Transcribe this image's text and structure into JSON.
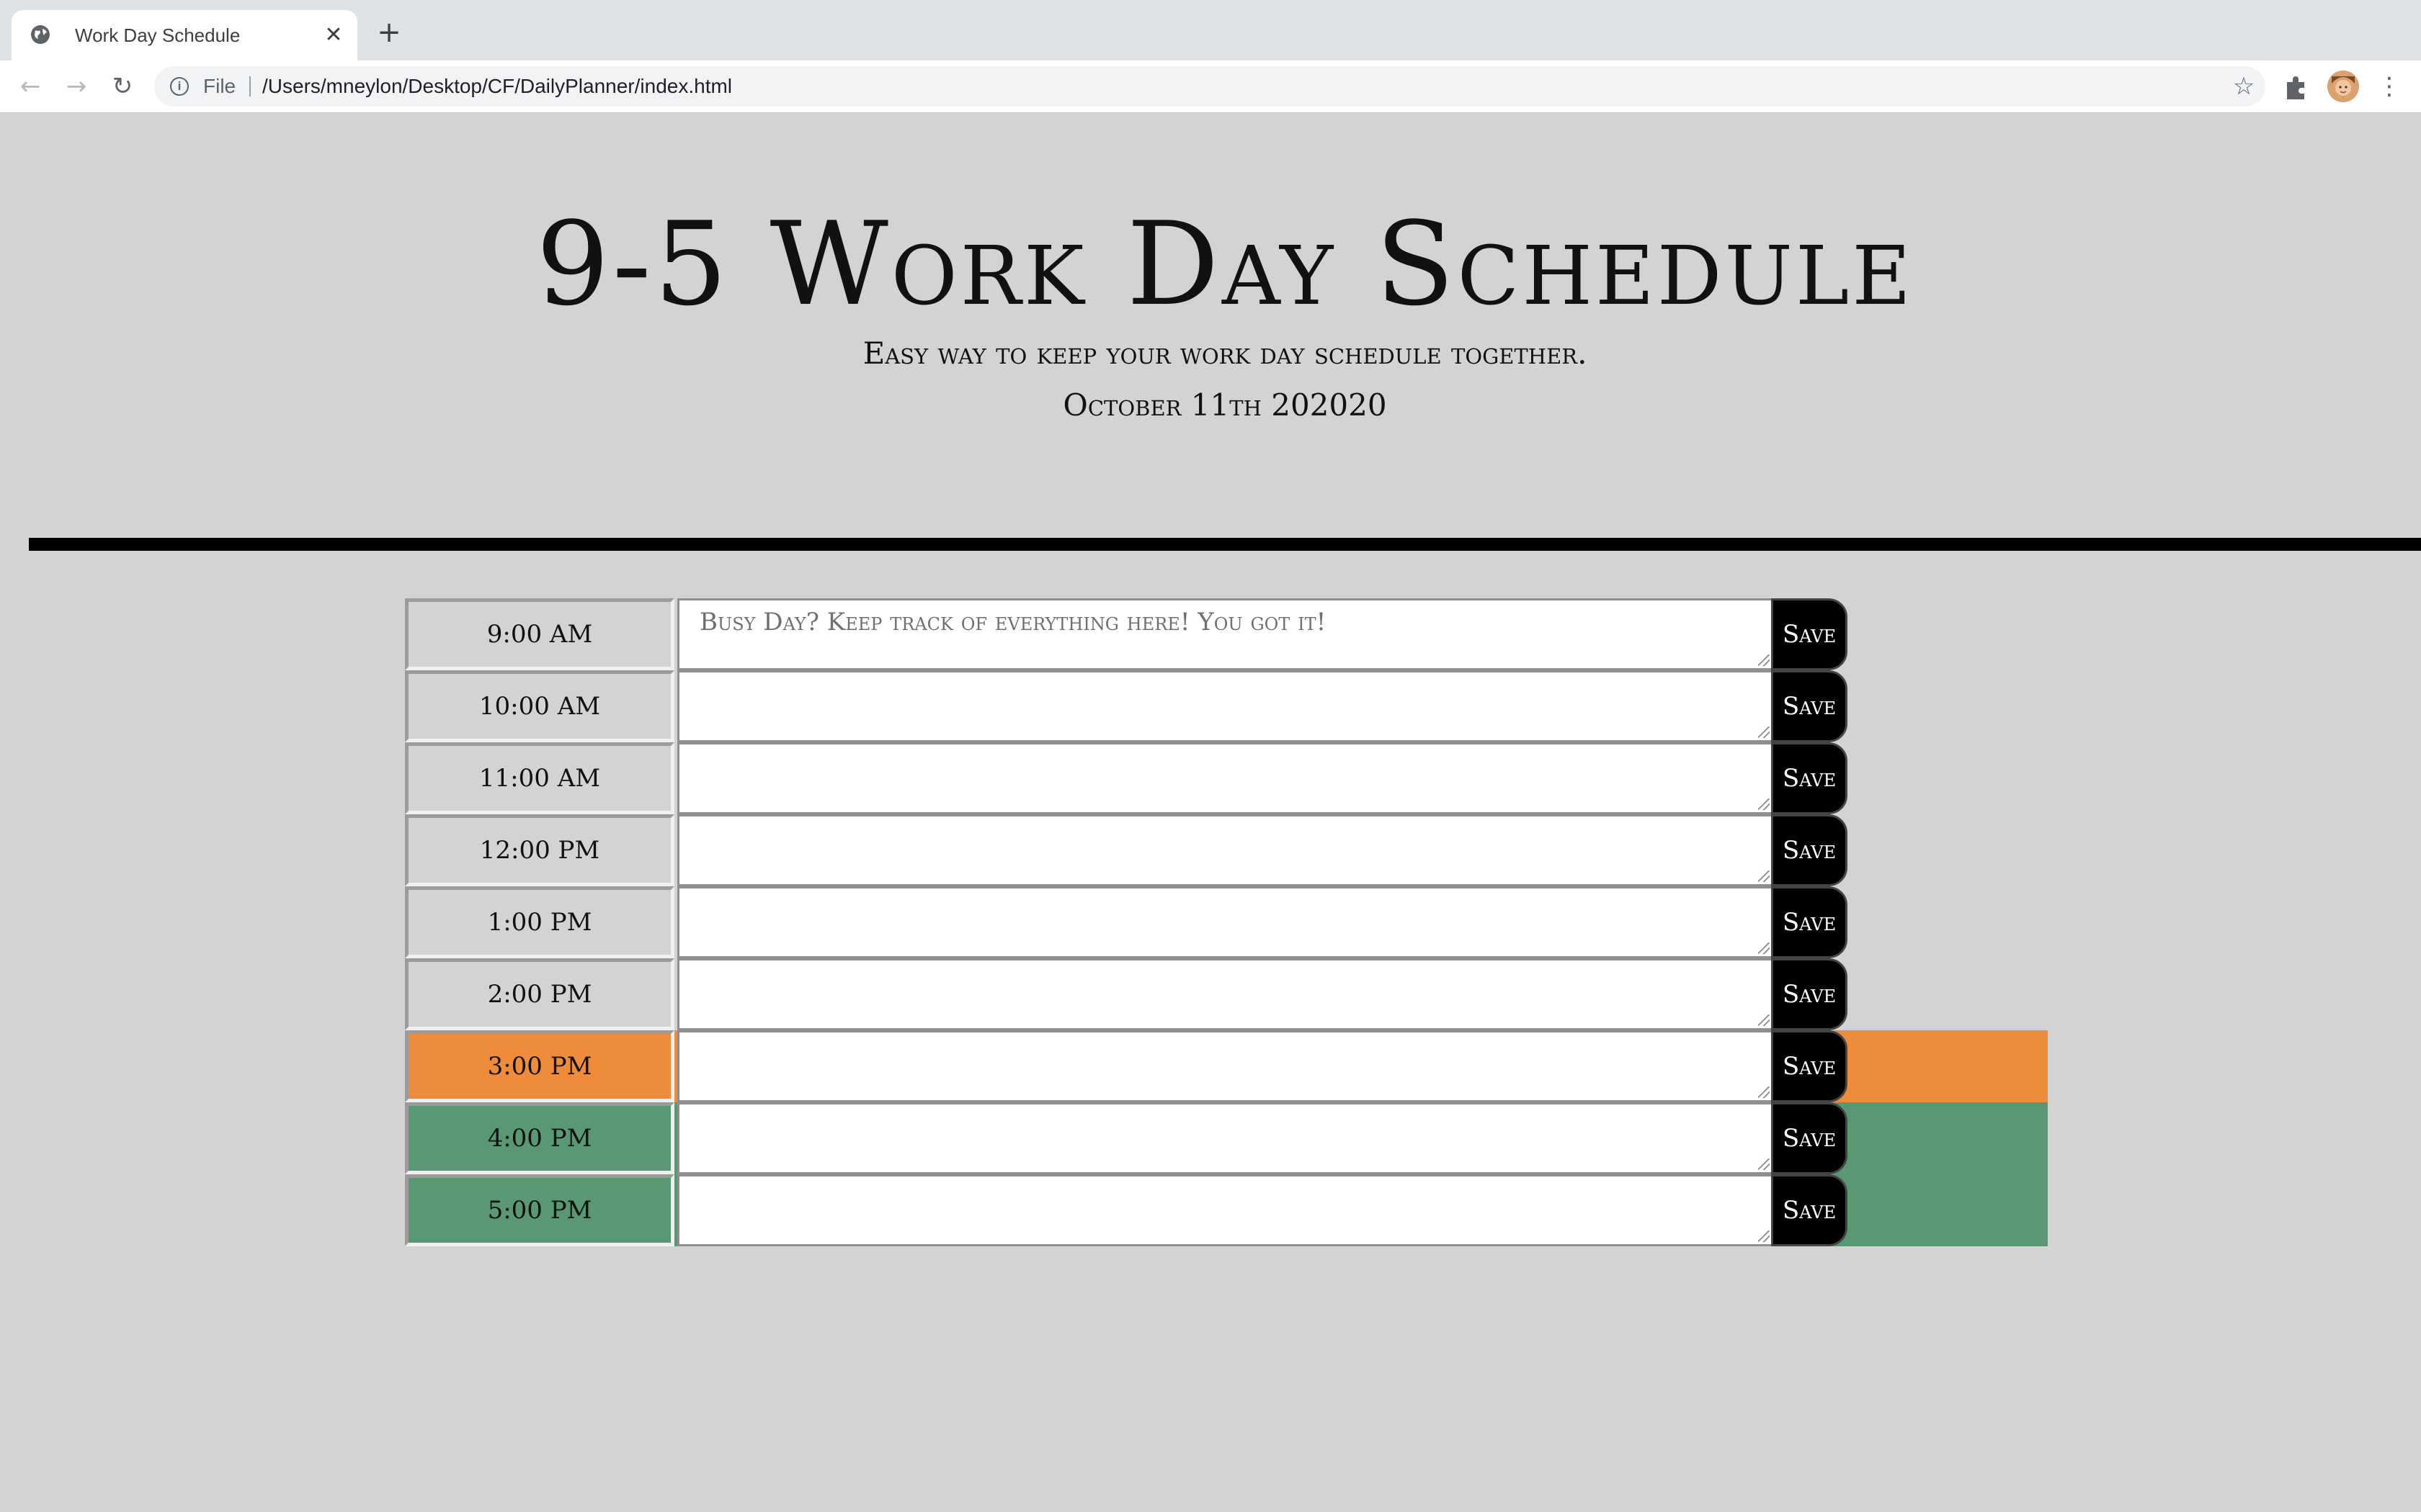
{
  "browser": {
    "tab_title": "Work Day Schedule",
    "url_scheme": "File",
    "url": "/Users/mneylon/Desktop/CF/DailyPlanner/index.html"
  },
  "header": {
    "title": "9-5 Work Day Schedule",
    "lead": "Easy way to keep your work day schedule together.",
    "current_day": "October 11th 202020"
  },
  "timeblocks": [
    {
      "hour": "9:00 AM",
      "text": "",
      "placeholder": "Busy Day? Keep track of everything here! You got it!",
      "state": "past"
    },
    {
      "hour": "10:00 AM",
      "text": "",
      "placeholder": "",
      "state": "past"
    },
    {
      "hour": "11:00 AM",
      "text": "",
      "placeholder": "",
      "state": "past"
    },
    {
      "hour": "12:00 PM",
      "text": "",
      "placeholder": "",
      "state": "past"
    },
    {
      "hour": "1:00 PM",
      "text": "",
      "placeholder": "",
      "state": "past"
    },
    {
      "hour": "2:00 PM",
      "text": "",
      "placeholder": "",
      "state": "past"
    },
    {
      "hour": "3:00 PM",
      "text": "",
      "placeholder": "",
      "state": "present"
    },
    {
      "hour": "4:00 PM",
      "text": "",
      "placeholder": "",
      "state": "future"
    },
    {
      "hour": "5:00 PM",
      "text": "",
      "placeholder": "",
      "state": "future"
    }
  ],
  "save_label": "Save",
  "colors": {
    "background": "#d3d3d3",
    "present": "#ef8c3c",
    "future": "#5a9874",
    "save_button": "#000000"
  }
}
